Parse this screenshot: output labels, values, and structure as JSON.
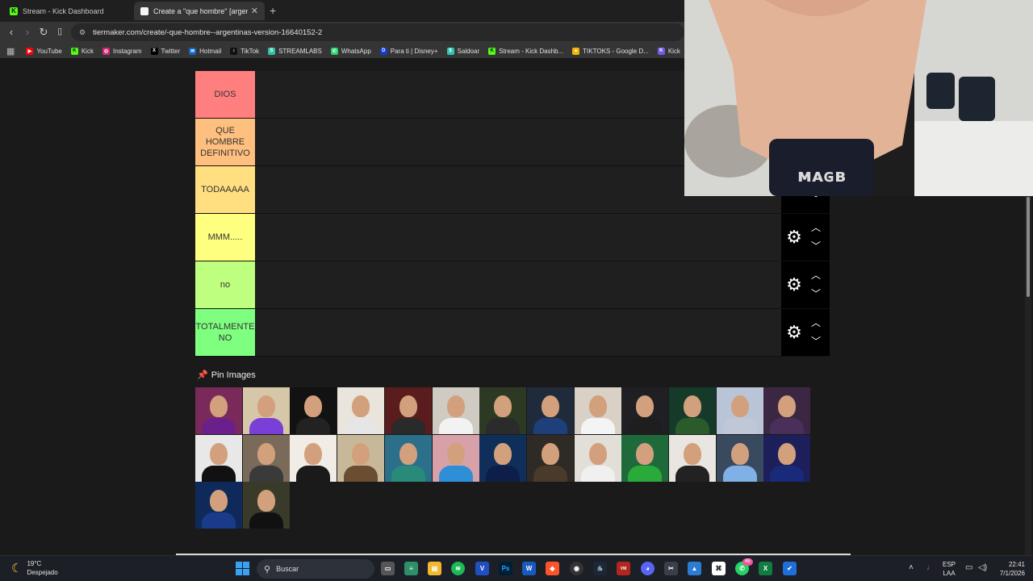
{
  "browser": {
    "tabs": [
      {
        "title": "Stream - Kick Dashboard",
        "active": false
      },
      {
        "title": "Create a \"que hombre\" [argentin",
        "active": true
      }
    ],
    "url": "tiermaker.com/create/-que-hombre--argentinas-version-16640152-2",
    "bookmarks": [
      "YouTube",
      "Kick",
      "Instagram",
      "Twitter",
      "Hotmail",
      "TikTok",
      "STREAMLABS",
      "WhatsApp",
      "Para ti | Disney+",
      "Saldoar",
      "Stream - Kick Dashb...",
      "TIKTOKS - Google D...",
      "Kick"
    ]
  },
  "tiers": [
    {
      "label": "DIOS",
      "color": "#ff7f7f"
    },
    {
      "label": "QUE HOMBRE DEFINITIVO",
      "color": "#ffbf7f"
    },
    {
      "label": "TODAAAAA",
      "color": "#ffdf7f"
    },
    {
      "label": "MMM.....",
      "color": "#ffff7f"
    },
    {
      "label": "no",
      "color": "#bfff7f"
    },
    {
      "label": "TOTALMENTE NO",
      "color": "#7fff7f"
    }
  ],
  "pin": {
    "label": "Pin Images"
  },
  "image_pool": {
    "count": 28
  },
  "taskbar": {
    "weather_temp": "19°C",
    "weather_desc": "Despejado",
    "search_placeholder": "Buscar",
    "whatsapp_badge": "45",
    "lang": "ESP",
    "lang_sub": "LAA",
    "time": "22:41",
    "date": "7/1/2026"
  }
}
